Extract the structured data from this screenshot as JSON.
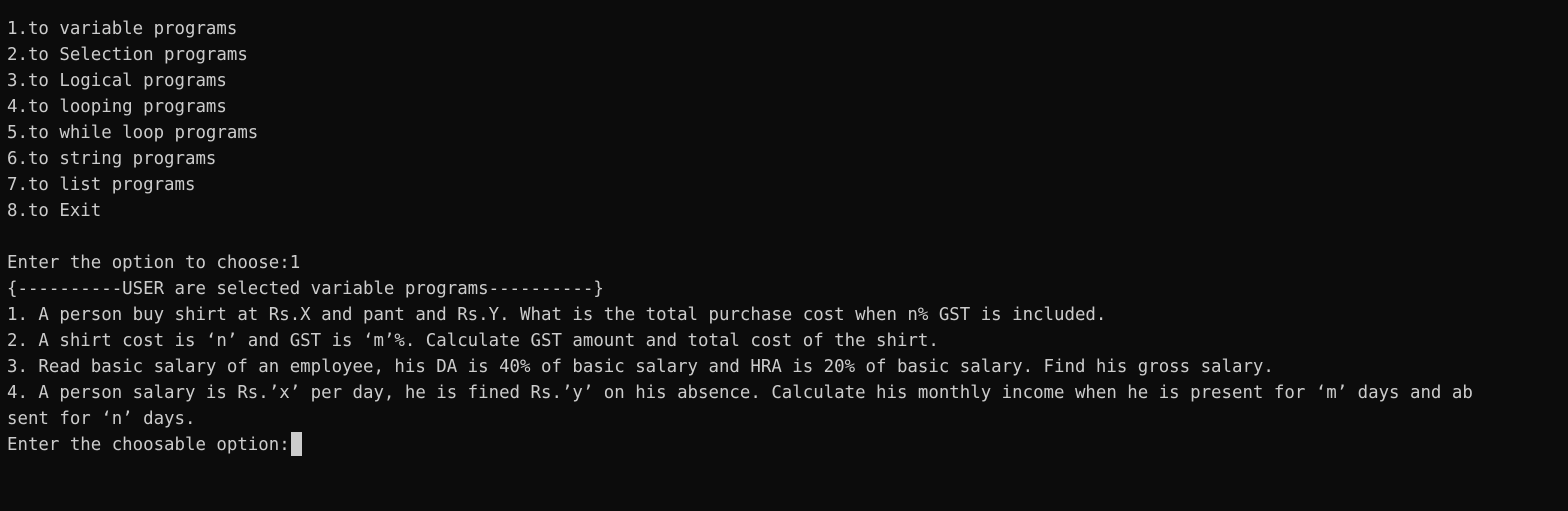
{
  "terminal": {
    "menu": [
      "1.to variable programs",
      "2.to Selection programs",
      "3.to Logical programs",
      "4.to looping programs",
      "5.to while loop programs",
      "6.to string programs",
      "7.to list programs",
      "8.to Exit"
    ],
    "prompt_choose": "Enter the option to choose:1",
    "selected_banner": "{----------USER are selected variable programs----------}",
    "programs": [
      "1. A person buy shirt at Rs.X and pant and Rs.Y. What is the total purchase cost when n% GST is included.",
      "2. A shirt cost is ‘n’ and GST is ‘m’%. Calculate GST amount and total cost of the shirt.",
      "3. Read basic salary of an employee, his DA is 40% of basic salary and HRA is 20% of basic salary. Find his gross salary.",
      "4. A person salary is Rs.’x’ per day, he is fined Rs.’y’ on his absence. Calculate his monthly income when he is present for ‘m’ days and ab",
      "sent for ‘n’ days."
    ],
    "prompt_option": "Enter the choosable option:"
  },
  "colors": {
    "background": "#0c0c0c",
    "foreground": "#cccccc"
  }
}
